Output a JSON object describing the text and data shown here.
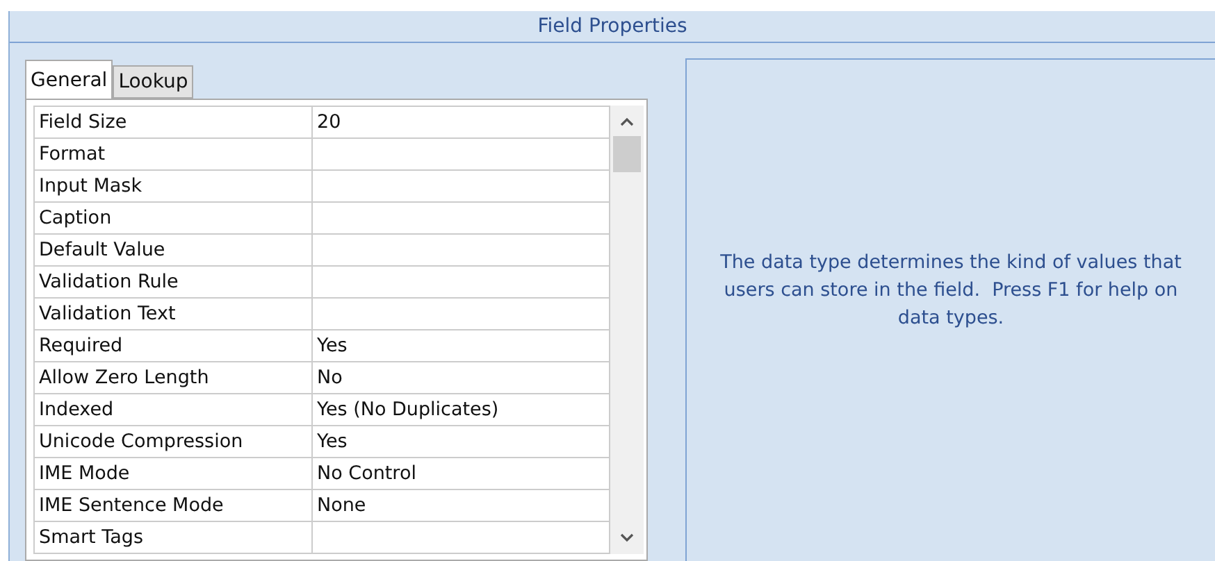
{
  "panel": {
    "title": "Field Properties"
  },
  "tabs": [
    {
      "label": "General",
      "selected": true
    },
    {
      "label": "Lookup",
      "selected": false
    }
  ],
  "properties": [
    {
      "name": "Field Size",
      "value": "20"
    },
    {
      "name": "Format"
    },
    {
      "name": "Input Mask"
    },
    {
      "name": "Caption"
    },
    {
      "name": "Default Value"
    },
    {
      "name": "Validation Rule"
    },
    {
      "name": "Validation Text"
    },
    {
      "name": "Required",
      "value": "Yes"
    },
    {
      "name": "Allow Zero Length",
      "value": "No"
    },
    {
      "name": "Indexed",
      "value": "Yes (No Duplicates)"
    },
    {
      "name": "Unicode Compression",
      "value": "Yes"
    },
    {
      "name": "IME Mode",
      "value": "No Control"
    },
    {
      "name": "IME Sentence Mode",
      "value": "None"
    },
    {
      "name": "Smart Tags"
    }
  ],
  "help_text": "The data type determines the kind of values that users can store in the field.  Press F1 for help on data types."
}
